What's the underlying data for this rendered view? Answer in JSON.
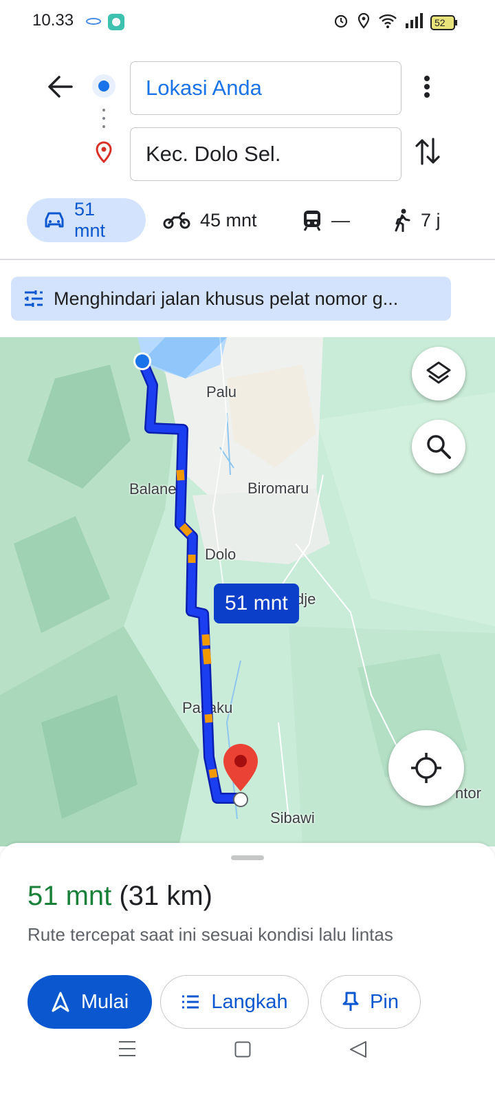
{
  "status_bar": {
    "time": "10.33",
    "battery": "52"
  },
  "directions": {
    "origin": "Lokasi Anda",
    "destination": "Kec. Dolo Sel."
  },
  "modes": [
    {
      "id": "car",
      "label": "51 mnt",
      "icon": "car-icon",
      "active": true
    },
    {
      "id": "motorcycle",
      "label": "45 mnt",
      "icon": "motorcycle-icon"
    },
    {
      "id": "transit",
      "label": "—",
      "icon": "train-icon"
    },
    {
      "id": "walk",
      "label": "7 j",
      "icon": "walk-icon"
    }
  ],
  "notice": "Menghindari jalan khusus pelat nomor g...",
  "map": {
    "labels": [
      "Palu",
      "Balane",
      "Biromaru",
      "Dolo",
      "dje",
      "Pasaku",
      "Sibawi",
      "ntor"
    ],
    "route_eta": "51 mnt"
  },
  "sheet": {
    "duration": "51 mnt",
    "distance": "(31 km)",
    "subtitle": "Rute tercepat saat ini sesuai kondisi lalu lintas",
    "start_label": "Mulai",
    "steps_label": "Langkah",
    "pin_label": "Pin"
  },
  "colors": {
    "accent": "#0b57d0",
    "route": "#1a3ef0",
    "traffic": "#f29900",
    "eta_green": "#188038"
  }
}
